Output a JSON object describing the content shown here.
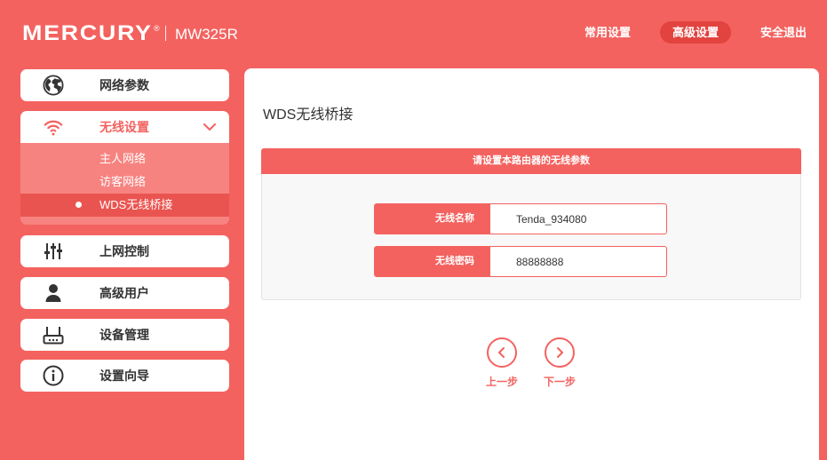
{
  "header": {
    "brand": "MERCURY",
    "brand_mark": "®",
    "model": "MW325R",
    "nav": [
      {
        "label": "常用设置",
        "active": false
      },
      {
        "label": "高级设置",
        "active": true
      },
      {
        "label": "安全退出",
        "active": false
      }
    ]
  },
  "sidebar": {
    "items": [
      {
        "label": "网络参数",
        "icon": "globe-icon",
        "active": false
      },
      {
        "label": "无线设置",
        "icon": "wifi-icon",
        "active": true,
        "expanded": true,
        "children": [
          {
            "label": "主人网络",
            "selected": false
          },
          {
            "label": "访客网络",
            "selected": false
          },
          {
            "label": "WDS无线桥接",
            "selected": true
          }
        ]
      },
      {
        "label": "上网控制",
        "icon": "sliders-icon",
        "active": false
      },
      {
        "label": "高级用户",
        "icon": "user-icon",
        "active": false
      },
      {
        "label": "设备管理",
        "icon": "router-icon",
        "active": false
      },
      {
        "label": "设置向导",
        "icon": "info-icon",
        "active": false
      }
    ]
  },
  "main": {
    "title": "WDS无线桥接",
    "panel_header": "请设置本路由器的无线参数",
    "fields": [
      {
        "label": "无线名称",
        "value": "Tenda_934080"
      },
      {
        "label": "无线密码",
        "value": "88888888"
      }
    ],
    "prev_button": {
      "label": "上一步",
      "icon": "chevron-left-icon"
    },
    "next_button": {
      "label": "下一步",
      "icon": "chevron-right-icon"
    }
  },
  "colors": {
    "accent": "#F3625F",
    "accent_dark": "#E2433F",
    "submenu_bg": "#F78380",
    "submenu_selected": "#EA5450",
    "text": "#333333",
    "panel_body": "#F8F8F8"
  }
}
